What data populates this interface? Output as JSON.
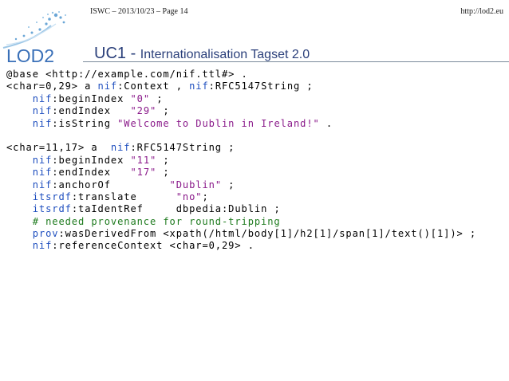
{
  "header": {
    "left": "ISWC – 2013/10/23 – Page 14",
    "right": "http://lod2.eu"
  },
  "logo": {
    "text": "LOD2"
  },
  "title": {
    "uc": "UC1",
    "sep": " - ",
    "rest": "Internationalisation Tagset 2.0"
  },
  "code": {
    "l1": "@base <http://example.com/nif.ttl#> .",
    "l2a": "<char=0,29> a ",
    "l2b": "nif",
    "l2c": ":Context , ",
    "l2d": "nif",
    "l2e": ":RFC5147String ;",
    "l3a": "    ",
    "l3b": "nif",
    "l3c": ":beginIndex ",
    "l3d": "\"0\"",
    "l3e": " ;",
    "l4a": "    ",
    "l4b": "nif",
    "l4c": ":endIndex   ",
    "l4d": "\"29\"",
    "l4e": " ;",
    "l5a": "    ",
    "l5b": "nif",
    "l5c": ":isString ",
    "l5d": "\"Welcome to Dublin in Ireland!\"",
    "l5e": " .",
    "l7a": "<char=11,17> a  ",
    "l7b": "nif",
    "l7c": ":RFC5147String ;",
    "l8a": "    ",
    "l8b": "nif",
    "l8c": ":beginIndex ",
    "l8d": "\"11\"",
    "l8e": " ;",
    "l9a": "    ",
    "l9b": "nif",
    "l9c": ":endIndex   ",
    "l9d": "\"17\"",
    "l9e": " ;",
    "l10a": "    ",
    "l10b": "nif",
    "l10c": ":anchorOf         ",
    "l10d": "\"Dublin\"",
    "l10e": " ;",
    "l11a": "    ",
    "l11b": "itsrdf",
    "l11c": ":translate      ",
    "l11d": "\"no\"",
    "l11e": ";",
    "l12a": "    ",
    "l12b": "itsrdf",
    "l12c": ":taIdentRef     dbpedia:Dublin ;",
    "l13": "    # needed provenance for round-tripping",
    "l14a": "    ",
    "l14b": "prov",
    "l14c": ":wasDerivedFrom <xpath(/html/body[1]/h2[1]/span[1]/text()[1])> ;",
    "l15a": "    ",
    "l15b": "nif",
    "l15c": ":referenceContext <char=0,29> ."
  },
  "colors": {
    "keyword": "#1f4fbf",
    "string": "#8a1a8a",
    "comment": "#1d7a1d",
    "title": "#2a3f7a"
  }
}
